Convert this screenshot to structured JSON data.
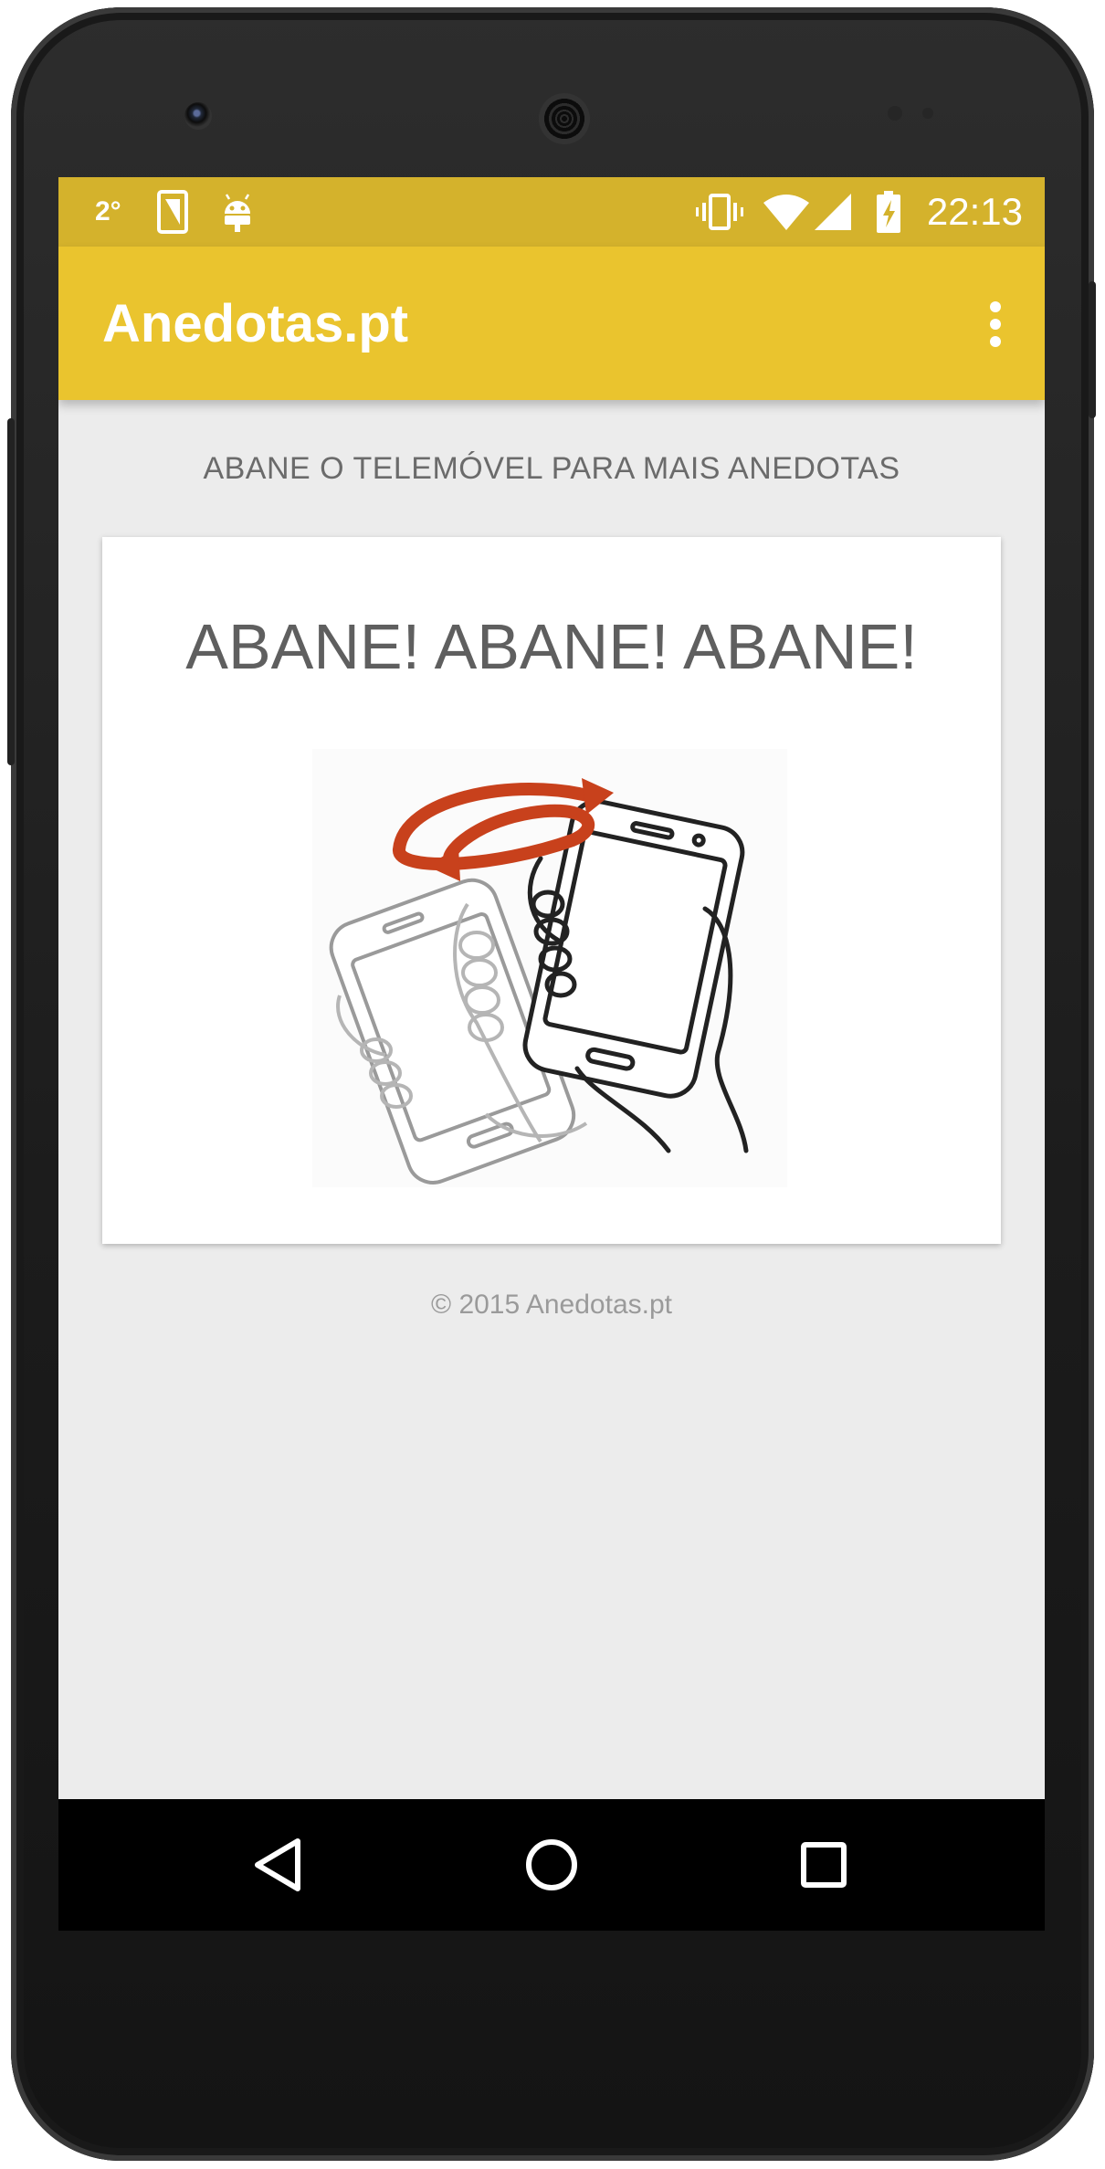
{
  "status_bar": {
    "temperature": "2°",
    "time": "22:13"
  },
  "app_bar": {
    "title": "Anedotas.pt",
    "menu_icon": "more-vert-icon"
  },
  "main": {
    "hint": "ABANE O TELEMÓVEL PARA MAIS ANEDOTAS",
    "card_title": "ABANE! ABANE! ABANE!",
    "illustration": "shake-phone-illustration",
    "footer": "© 2015 Anedotas.pt"
  },
  "nav_bar": {
    "icons": [
      "back-icon",
      "home-icon",
      "recents-icon"
    ]
  },
  "colors": {
    "status_bar": "#d4b22c",
    "app_bar": "#eac42e",
    "background": "#ececec",
    "arrow": "#c8411c"
  }
}
